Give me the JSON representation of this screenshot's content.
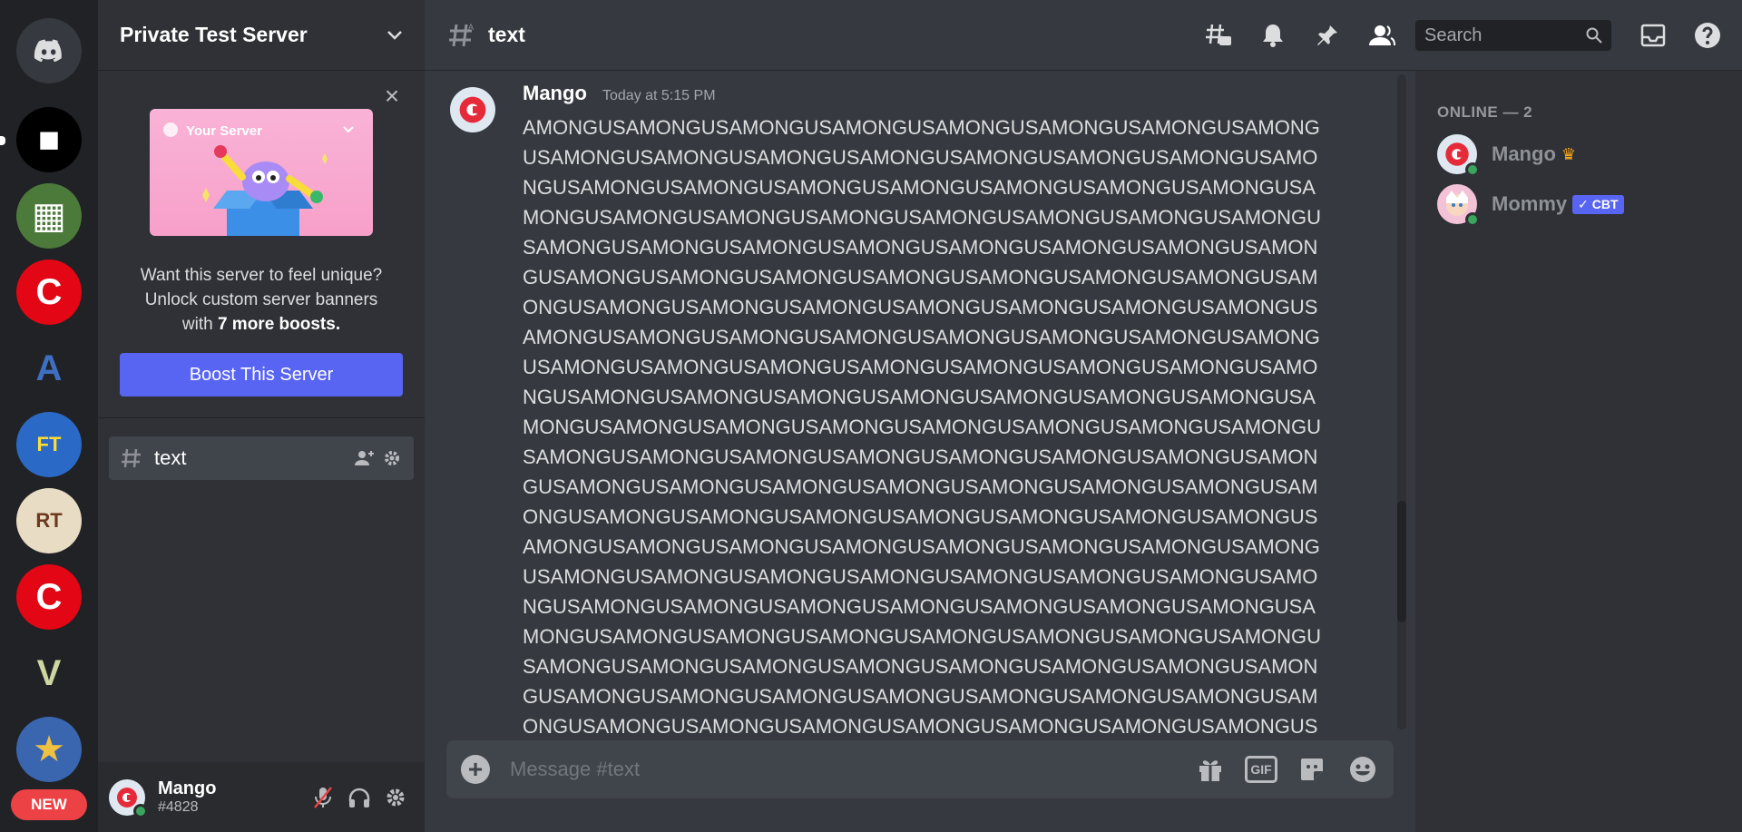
{
  "colors": {
    "accent": "#5865f2",
    "online": "#3ba55d",
    "danger": "#ed4245",
    "crown": "#faa81a"
  },
  "rail": {
    "home_icon": "discord-logo-icon",
    "servers": [
      {
        "name": "roblox-server",
        "bg": "#000000",
        "color": "#ffffff",
        "glyph": "■"
      },
      {
        "name": "minecraft-server",
        "bg": "#4b7a3a",
        "color": "#ffffff",
        "glyph": "▦"
      },
      {
        "name": "c-server-1",
        "bg": "#e30614",
        "color": "#ffffff",
        "glyph": "C"
      },
      {
        "name": "a-logo-server",
        "bg": "#202225",
        "color": "#3f6fc2",
        "glyph": "A"
      },
      {
        "name": "first-try-server",
        "bg": "#2a69c6",
        "color": "#ffdd33",
        "glyph": "FT"
      },
      {
        "name": "road-trip-server",
        "bg": "#e9dcc4",
        "color": "#6b3a1e",
        "glyph": "RT"
      },
      {
        "name": "c-server-2",
        "bg": "#e30614",
        "color": "#ffffff",
        "glyph": "C"
      },
      {
        "name": "gta-server",
        "bg": "#202225",
        "color": "#cfd6a0",
        "glyph": "V"
      },
      {
        "name": "fnaf-server",
        "bg": "#3a66b0",
        "color": "#f0c040",
        "glyph": "★"
      }
    ],
    "new_badge": "NEW"
  },
  "sidebar": {
    "server_name": "Private Test Server",
    "banner_label": "Your Server",
    "boost_line1": "Want this server to feel unique?",
    "boost_line2": "Unlock custom server banners",
    "boost_line3_prefix": "with ",
    "boost_line3_bold": "7 more boosts.",
    "boost_button": "Boost This Server",
    "channel": {
      "icon": "hash-icon",
      "name": "text"
    }
  },
  "user": {
    "name": "Mango",
    "tag": "#4828"
  },
  "chat": {
    "channel_name": "text",
    "search_placeholder": "Search",
    "message": {
      "author": "Mango",
      "timestamp": "Today at 5:15 PM",
      "content": "AMONGUSAMONGUSAMONGUSAMONGUSAMONGUSAMONGUSAMONGUSAMONGUSAMONGUSAMONGUSAMONGUSAMONGUSAMONGUSAMONGUSAMONGUSAMONGUSAMONGUSAMONGUSAMONGUSAMONGUSAMONGUSAMONGUSAMONGUSAMONGUSAMONGUSAMONGUSAMONGUSAMONGUSAMONGUSAMONGUSAMONGUSAMONGUSAMONGUSAMONGUSAMONGUSAMONGUSAMONGUSAMONGUSAMONGUSAMONGUSAMONGUSAMONGUSAMONGUSAMONGUSAMONGUSAMONGUSAMONGUSAMONGUSAMONGUSAMONGUSAMONGUSAMONGUSAMONGUSAMONGUSAMONGUSAMONGUSAMONGUSAMONGUSAMONGUSAMONGUSAMONGUSAMONGUSAMONGUSAMONGUSAMONGUSAMONGUSAMONGUSAMONGUSAMONGUSAMONGUSAMONGUSAMONGUSAMONGUSAMONGUSAMONGUSAMONGUSAMONGUSAMONGUSAMONGUSAMONGUSAMONGUSAMONGUSAMONGUSAMONGUSAMONGUSAMONGUSAMONGUSAMONGUSAMONGUSAMONGUSAMONGUSAMONGUSAMONGUSAMONGUSAMONGUSAMONGUSAMONGUSAMONGUSAMONGUSAMONGUSAMONGUSAMONGUSAMONGUSAMONGUSAMONGUSAMONGUSAMONGUSAMONGUSAMONGUSAMONGUSAMONGUSAMONGUSAMONGUSAMONGUSAMONGUSAMONGUSAMONGUSAMONGUSAMONGUSAMONGUSAMONGUSAMONGUSAMONGUSAMONGUSAMONGUSAMONGUSAMONGUSAMONGUSAMONGUSAMONGUSAMONGUSAMONGUSAMONGUSAMONGUSAMONGUSAMONGUSAMONGUSAMONGUSAMONGUSAMONGUSAMONGUSAMONGUSAMONGUSAMONGUSAMONGUSAMONGUSAMONGUSAMONGUSAMONGUSAMONGUSAMONGUSAMONGUSAMONGUSAMONGUSAMONGUSAMONGUSAMONGUSAMONGUSAMONGUSAMONGUSAMONGUSAMONGUSAMONGUSAMONGUSAMONGUSAMONGUSAMONGUSAMONGUSAMONGUSAMONGUSAMONGUSAMONGUSAMONGUSAMONGUSAMONGUSAMONGUSAMONGUSAMONGUSAMONGUSAMO"
    },
    "composer_placeholder": "Message #text",
    "gif_label": "GIF"
  },
  "members": {
    "heading": "ONLINE — 2",
    "list": [
      {
        "name": "Mango",
        "badge": "crown-icon"
      },
      {
        "name": "Mommy",
        "bot_tag": "✓ CBT"
      }
    ]
  }
}
